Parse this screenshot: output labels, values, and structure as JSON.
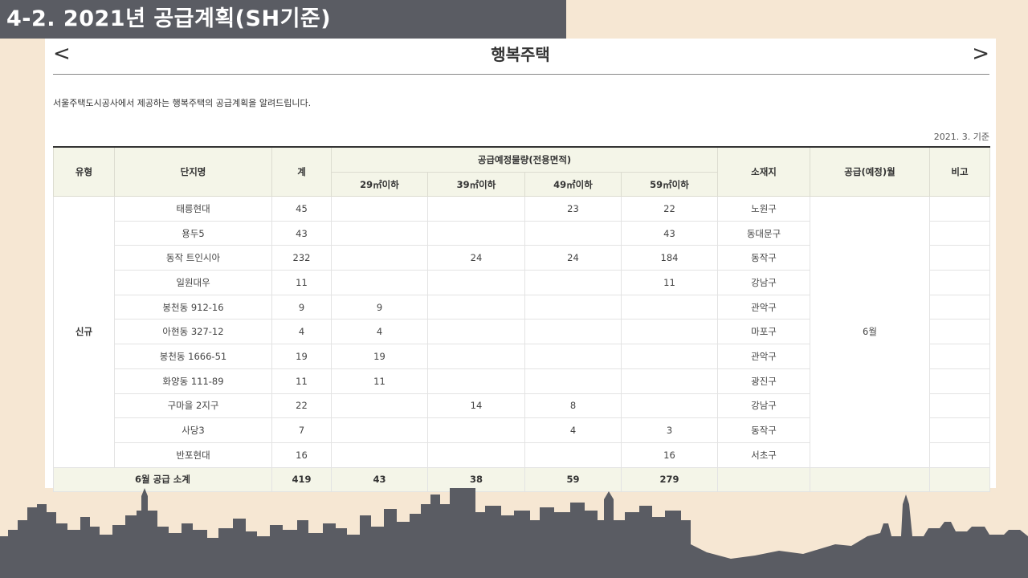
{
  "slide": {
    "title": "4-2. 2021년 공급계획(SH기준)"
  },
  "panel": {
    "nav_prev": "<",
    "nav_next": ">",
    "title": "행복주택",
    "intro": "서울주택도시공사에서 제공하는 행복주택의 공급계획을 알려드립니다.",
    "date": "2021. 3. 기준"
  },
  "table": {
    "headers": {
      "type": "유형",
      "name": "단지명",
      "total": "계",
      "group": "공급예정물량(전용면적)",
      "sizes": [
        "29㎡이하",
        "39㎡이하",
        "49㎡이하",
        "59㎡이하"
      ],
      "location": "소재지",
      "month": "공급(예정)월",
      "note": "비고"
    },
    "type_value": "신규",
    "month_value": "6월",
    "rows": [
      {
        "name": "태릉현대",
        "total": "45",
        "s29": "",
        "s39": "",
        "s49": "23",
        "s59": "22",
        "location": "노원구"
      },
      {
        "name": "용두5",
        "total": "43",
        "s29": "",
        "s39": "",
        "s49": "",
        "s59": "43",
        "location": "동대문구"
      },
      {
        "name": "동작 트인시아",
        "total": "232",
        "s29": "",
        "s39": "24",
        "s49": "24",
        "s59": "184",
        "location": "동작구"
      },
      {
        "name": "일원대우",
        "total": "11",
        "s29": "",
        "s39": "",
        "s49": "",
        "s59": "11",
        "location": "강남구"
      },
      {
        "name": "봉천동 912-16",
        "total": "9",
        "s29": "9",
        "s39": "",
        "s49": "",
        "s59": "",
        "location": "관악구"
      },
      {
        "name": "아현동 327-12",
        "total": "4",
        "s29": "4",
        "s39": "",
        "s49": "",
        "s59": "",
        "location": "마포구"
      },
      {
        "name": "봉천동 1666-51",
        "total": "19",
        "s29": "19",
        "s39": "",
        "s49": "",
        "s59": "",
        "location": "관악구"
      },
      {
        "name": "화양동 111-89",
        "total": "11",
        "s29": "11",
        "s39": "",
        "s49": "",
        "s59": "",
        "location": "광진구"
      },
      {
        "name": "구마을 2지구",
        "total": "22",
        "s29": "",
        "s39": "14",
        "s49": "8",
        "s59": "",
        "location": "강남구"
      },
      {
        "name": "사당3",
        "total": "7",
        "s29": "",
        "s39": "",
        "s49": "4",
        "s59": "3",
        "location": "동작구"
      },
      {
        "name": "반포현대",
        "total": "16",
        "s29": "",
        "s39": "",
        "s49": "",
        "s59": "16",
        "location": "서초구"
      }
    ],
    "total_row": {
      "label": "6월 공급 소계",
      "total": "419",
      "s29": "43",
      "s39": "38",
      "s49": "59",
      "s59": "279"
    }
  },
  "colors": {
    "background": "#f6e7d3",
    "title_bar": "#5a5c63",
    "header_bg": "#f4f5e8",
    "skyline": "#5a5c63"
  }
}
